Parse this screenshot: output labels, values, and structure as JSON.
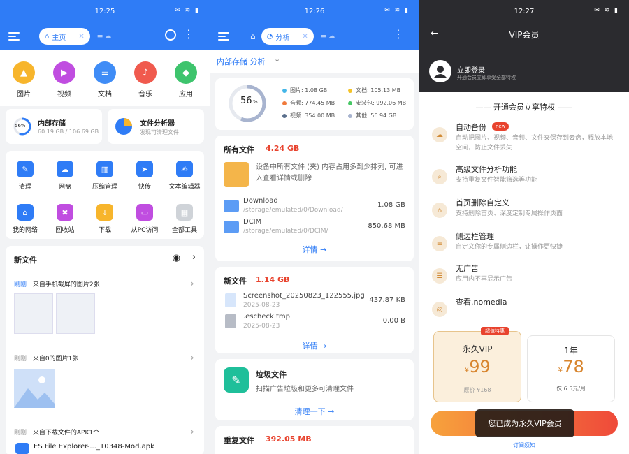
{
  "home": {
    "time": "12:25",
    "tab_label": "主页",
    "categories": [
      {
        "label": "图片",
        "icon": "image-icon",
        "color": "#f7b52c"
      },
      {
        "label": "视频",
        "icon": "video-icon",
        "color": "#c04de0"
      },
      {
        "label": "文档",
        "icon": "document-icon",
        "color": "#3f8cf6"
      },
      {
        "label": "音乐",
        "icon": "music-icon",
        "color": "#f05a4e"
      },
      {
        "label": "应用",
        "icon": "android-icon",
        "color": "#3ec46d"
      }
    ],
    "storage": {
      "title": "内部存储",
      "percent": "56%",
      "usage": "60.19 GB / 106.69 GB"
    },
    "analyzer": {
      "title": "文件分析器",
      "subtitle": "发现可清理文件"
    },
    "tools": [
      {
        "label": "清理",
        "icon": "broom-icon",
        "color": "#2f7cf6"
      },
      {
        "label": "网盘",
        "icon": "cloud-icon",
        "color": "#2f7cf6"
      },
      {
        "label": "压缩管理",
        "icon": "zip-icon",
        "color": "#2f7cf6"
      },
      {
        "label": "快传",
        "icon": "send-icon",
        "color": "#2f7cf6"
      },
      {
        "label": "文本编辑器",
        "icon": "text-editor-icon",
        "color": "#2f7cf6"
      },
      {
        "label": "我的网络",
        "icon": "network-icon",
        "color": "#2f7cf6"
      },
      {
        "label": "回收站",
        "icon": "trash-icon",
        "color": "#c04de0"
      },
      {
        "label": "下载",
        "icon": "download-icon",
        "color": "#f7b52c"
      },
      {
        "label": "从PC访问",
        "icon": "pc-icon",
        "color": "#c04de0"
      },
      {
        "label": "全部工具",
        "icon": "grid-icon",
        "color": "#cfd3d8"
      }
    ],
    "new_files_title": "新文件",
    "groups": [
      {
        "time": "刚刚",
        "desc": "来自手机截屏的图片2张"
      },
      {
        "time": "刚刚",
        "desc": "来自0的图片1张"
      },
      {
        "time": "刚刚",
        "desc": "来自下载文件的APK1个"
      }
    ],
    "apk_name": "ES File Explorer-..._10348-Mod.apk"
  },
  "analysis": {
    "time": "12:26",
    "tab_label": "分析",
    "header": "内部存储 分析",
    "percent": "56",
    "percent_sign": "%",
    "legend": [
      {
        "label": "图片: 1.08 GB",
        "color": "#43b6e8"
      },
      {
        "label": "文档: 105.13 MB",
        "color": "#f4c328"
      },
      {
        "label": "音频: 774.45 MB",
        "color": "#f07a3c"
      },
      {
        "label": "安装包: 992.06 MB",
        "color": "#47c765"
      },
      {
        "label": "视频: 354.00 MB",
        "color": "#5a6f8c"
      },
      {
        "label": "其他: 56.94 GB",
        "color": "#a8b4cf"
      }
    ],
    "all_files": {
      "title": "所有文件",
      "size": "4.24 GB",
      "hint": "设备中所有文件 (夹) 内存占用多到少排列, 可进入查看详情或删除"
    },
    "folders": [
      {
        "name": "Download",
        "path": "/storage/emulated/0/Download/",
        "size": "1.08 GB"
      },
      {
        "name": "DCIM",
        "path": "/storage/emulated/0/DCIM/",
        "size": "850.68 MB"
      }
    ],
    "details_label": "详情",
    "new_files": {
      "title": "新文件",
      "size": "1.14 GB"
    },
    "new_list": [
      {
        "name": "Screenshot_20250823_122555.jpg",
        "date": "2025-08-23",
        "size": "437.87 KB"
      },
      {
        "name": ".escheck.tmp",
        "date": "2025-08-23",
        "size": "0.00 B"
      }
    ],
    "junk": {
      "title": "垃圾文件",
      "desc": "扫描广告垃圾和更多可清理文件",
      "action": "清理一下"
    },
    "dup": {
      "title": "重复文件",
      "size": "392.05 MB"
    }
  },
  "vip": {
    "time": "12:27",
    "title": "VIP会员",
    "login": "立即登录",
    "login_sub": "开通会员立即享受全部特权",
    "section": "开通会员立享特权",
    "features": [
      {
        "title": "自动备份",
        "badge": "new",
        "desc": "自动把图片、视频、音频、文件夹保存到云盘，释放本地空间，防止文件丢失"
      },
      {
        "title": "高级文件分析功能",
        "desc": "支持重复文件智能筛选等功能"
      },
      {
        "title": "首页删除自定义",
        "desc": "支持删除首页、深度定制专属操作页面"
      },
      {
        "title": "侧边栏管理",
        "desc": "自定义你的专属侧边栏，让操作更快捷"
      },
      {
        "title": "无广告",
        "desc": "应用内不再显示广告"
      },
      {
        "title": "查看.nomedia",
        "desc": ""
      }
    ],
    "plan_badge": "超值特惠",
    "plans": [
      {
        "name": "永久VIP",
        "price": "99",
        "currency": "¥",
        "orig": "原价 ¥168"
      },
      {
        "name": "1年",
        "price": "78",
        "currency": "¥",
        "orig": "仅 6.5元/月"
      }
    ],
    "toast": "您已成为永久VIP会员",
    "terms": "订阅须知"
  }
}
